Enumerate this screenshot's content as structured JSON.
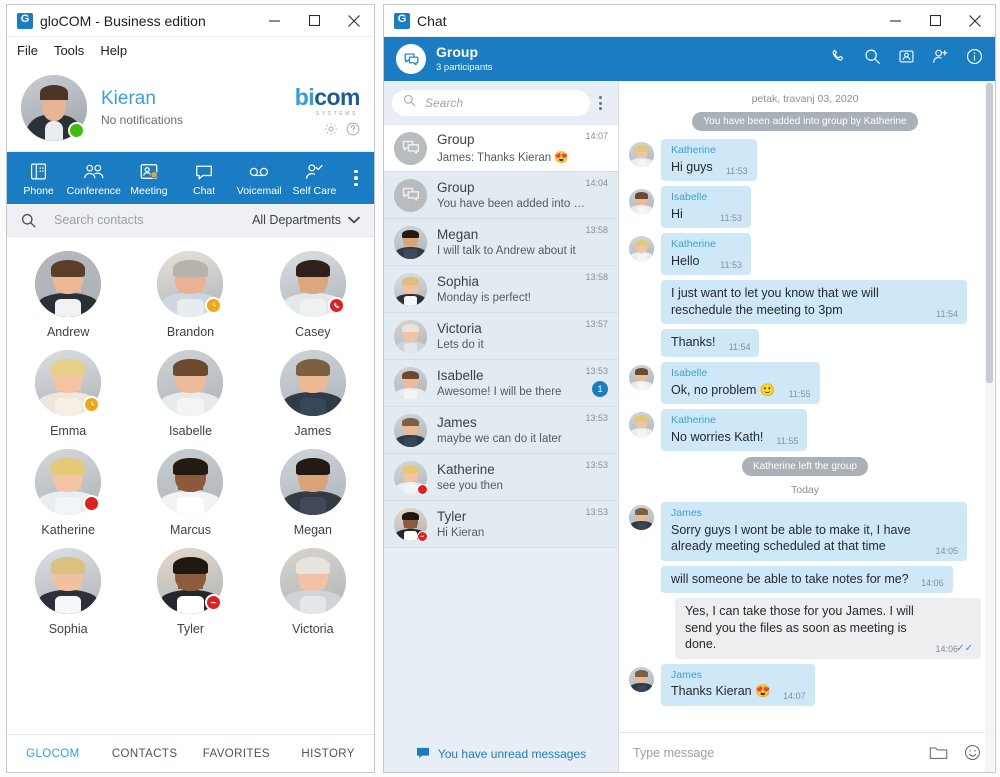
{
  "glocom_window": {
    "title": "gloCOM - Business edition",
    "logo_letter": "G",
    "controls": {
      "minimize": "minimize-icon",
      "maximize": "maximize-icon",
      "close": "close-icon"
    },
    "menu": [
      "File",
      "Tools",
      "Help"
    ],
    "profile": {
      "name": "Kieran",
      "status_text": "No notifications",
      "presence": "available",
      "brand_primary": "bi",
      "brand_secondary": "com",
      "brand_tagline": "SYSTEMS",
      "settings_icon": "gear-icon",
      "help_icon": "help-icon"
    },
    "toolbar": {
      "accent": "#1a7dc4",
      "items": [
        {
          "label": "Phone",
          "icon": "phone-keypad-icon"
        },
        {
          "label": "Conference",
          "icon": "conference-group-icon"
        },
        {
          "label": "Meeting",
          "icon": "meeting-icon"
        },
        {
          "label": "Chat",
          "icon": "chat-bubble-icon"
        },
        {
          "label": "Voicemail",
          "icon": "voicemail-icon"
        },
        {
          "label": "Self Care",
          "icon": "self-care-icon"
        }
      ],
      "more_icon": "more-vertical-icon"
    },
    "contacts_search": {
      "icon": "search-icon",
      "placeholder": "Search contacts",
      "department": "All Departments",
      "chevron": "chevron-down-icon"
    },
    "contacts": [
      {
        "name": "Andrew",
        "presence": "none"
      },
      {
        "name": "Brandon",
        "presence": "away"
      },
      {
        "name": "Casey",
        "presence": "oncall"
      },
      {
        "name": "Emma",
        "presence": "away"
      },
      {
        "name": "Isabelle",
        "presence": "none"
      },
      {
        "name": "James",
        "presence": "none"
      },
      {
        "name": "Katherine",
        "presence": "busy"
      },
      {
        "name": "Marcus",
        "presence": "none"
      },
      {
        "name": "Megan",
        "presence": "none"
      },
      {
        "name": "Sophia",
        "presence": "none"
      },
      {
        "name": "Tyler",
        "presence": "dnd"
      },
      {
        "name": "Victoria",
        "presence": "none"
      }
    ],
    "bottom_tabs": [
      {
        "label": "GLOCOM",
        "active": true
      },
      {
        "label": "CONTACTS",
        "active": false
      },
      {
        "label": "FAVORITES",
        "active": false
      },
      {
        "label": "HISTORY",
        "active": false
      }
    ]
  },
  "chat_window": {
    "title": "Chat",
    "logo_letter": "G",
    "controls": {
      "minimize": "minimize-icon",
      "maximize": "maximize-icon",
      "close": "close-icon"
    },
    "header": {
      "avatar_icon": "group-chat-icon",
      "title": "Group",
      "subtitle": "3 participants",
      "actions": [
        "phone-call-icon",
        "search-icon",
        "video-contact-icon",
        "add-person-icon",
        "info-icon"
      ]
    },
    "sidebar": {
      "search": {
        "icon": "search-icon",
        "placeholder": "Search"
      },
      "menu_icon": "more-vertical-icon",
      "conversations": [
        {
          "name": "Group",
          "preview": "James: Thanks Kieran 😍",
          "time": "14:07",
          "selected": true,
          "avatar": "group",
          "presence": "none",
          "unread": ""
        },
        {
          "name": "Group",
          "preview": "You have been added into grou...",
          "time": "14:04",
          "selected": false,
          "avatar": "group",
          "presence": "none",
          "unread": ""
        },
        {
          "name": "Megan",
          "preview": "I will talk to Andrew about it",
          "time": "13:58",
          "selected": false,
          "avatar": "megan",
          "presence": "none",
          "unread": ""
        },
        {
          "name": "Sophia",
          "preview": "Monday is perfect!",
          "time": "13:58",
          "selected": false,
          "avatar": "sophia",
          "presence": "none",
          "unread": ""
        },
        {
          "name": "Victoria",
          "preview": "Lets do it",
          "time": "13:57",
          "selected": false,
          "avatar": "victoria",
          "presence": "none",
          "unread": ""
        },
        {
          "name": "Isabelle",
          "preview": "Awesome! I will be there",
          "time": "13:53",
          "selected": false,
          "avatar": "isabelle",
          "presence": "none",
          "unread": "1"
        },
        {
          "name": "James",
          "preview": "maybe we can do it later",
          "time": "13:53",
          "selected": false,
          "avatar": "james",
          "presence": "none",
          "unread": ""
        },
        {
          "name": "Katherine",
          "preview": "see you then",
          "time": "13:53",
          "selected": false,
          "avatar": "katherine",
          "presence": "busy",
          "unread": ""
        },
        {
          "name": "Tyler",
          "preview": "Hi Kieran",
          "time": "13:53",
          "selected": false,
          "avatar": "tyler",
          "presence": "dnd",
          "unread": ""
        }
      ],
      "footer": {
        "icon": "chat-bubble-icon",
        "label": "You have unread messages"
      }
    },
    "thread": {
      "date_header": "petak, travanj 03, 2020",
      "items": [
        {
          "kind": "system",
          "text": "You have been added into group by Katherine"
        },
        {
          "kind": "in",
          "sender": "Katherine",
          "text": "Hi guys",
          "time": "11:53",
          "avatar": "katherine",
          "show_avatar": true
        },
        {
          "kind": "in",
          "sender": "Isabelle",
          "text": "Hi",
          "time": "11:53",
          "avatar": "isabelle",
          "show_avatar": true
        },
        {
          "kind": "in",
          "sender": "Katherine",
          "text": "Hello",
          "time": "11:53",
          "avatar": "katherine",
          "show_avatar": true
        },
        {
          "kind": "in",
          "sender": "",
          "text": "I just want to let you know that we will reschedule the meeting to 3pm",
          "time": "11:54",
          "avatar": "katherine",
          "show_avatar": false
        },
        {
          "kind": "in",
          "sender": "",
          "text": "Thanks!",
          "time": "11:54",
          "avatar": "katherine",
          "show_avatar": false
        },
        {
          "kind": "in",
          "sender": "Isabelle",
          "text": "Ok, no problem 🙂",
          "time": "11:55",
          "avatar": "isabelle",
          "show_avatar": true
        },
        {
          "kind": "in",
          "sender": "Katherine",
          "text": "No worries Kath!",
          "time": "11:55",
          "avatar": "katherine",
          "show_avatar": true
        },
        {
          "kind": "system",
          "text": "Katherine left the group"
        },
        {
          "kind": "day",
          "text": "Today"
        },
        {
          "kind": "in",
          "sender": "James",
          "text": "Sorry guys I wont be able to make it, I have already meeting scheduled at that time",
          "time": "14:05",
          "avatar": "james",
          "show_avatar": true
        },
        {
          "kind": "in",
          "sender": "",
          "text": "will someone be able to take notes for me?",
          "time": "14:06",
          "avatar": "james",
          "show_avatar": false
        },
        {
          "kind": "out",
          "sender": "",
          "text": "Yes, I can take those for you James. I will send you the files as soon as meeting is done.",
          "time": "14:06",
          "read": true
        },
        {
          "kind": "in",
          "sender": "James",
          "text": "Thanks Kieran 😍",
          "time": "14:07",
          "avatar": "james",
          "show_avatar": true
        }
      ]
    },
    "composer": {
      "placeholder": "Type message",
      "attach_icon": "folder-icon",
      "emoji_icon": "emoji-icon"
    }
  }
}
